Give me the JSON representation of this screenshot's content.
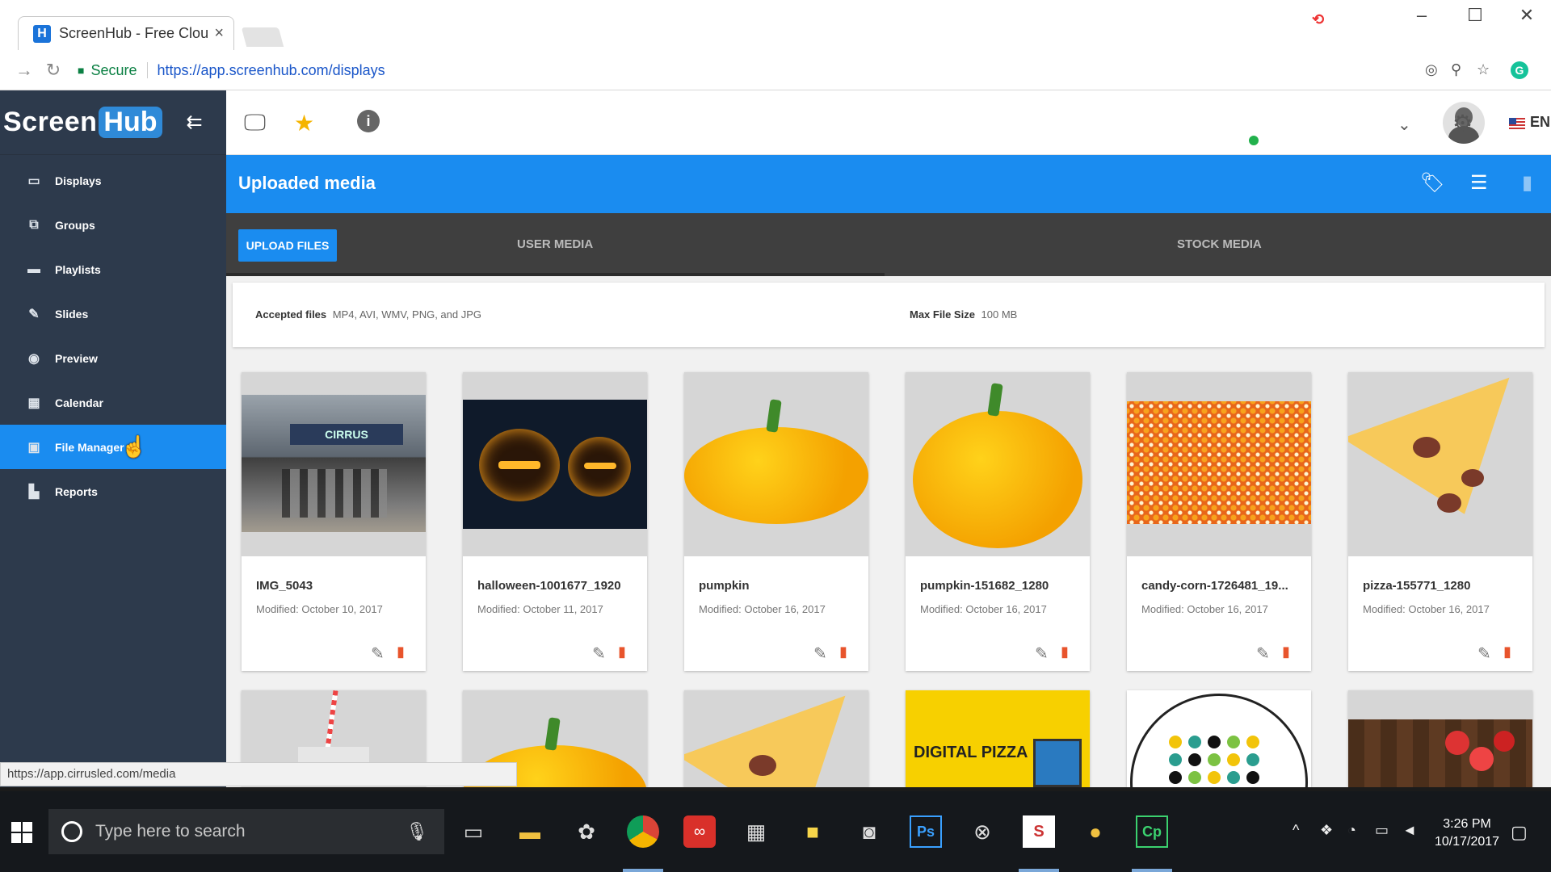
{
  "browser": {
    "tab_title": "ScreenHub - Free Clou",
    "tab_favicon": "H",
    "tab_close": "×",
    "secure_label": "Secure",
    "url": "https://app.screenhub.com/displays"
  },
  "sidebar": {
    "logo_screen": "Screen",
    "logo_hub": "Hub",
    "items": [
      {
        "label": "Displays",
        "icon": "monitor-icon",
        "glyph": "▭"
      },
      {
        "label": "Groups",
        "icon": "groups-icon",
        "glyph": "⧉"
      },
      {
        "label": "Playlists",
        "icon": "playlist-icon",
        "glyph": "▬"
      },
      {
        "label": "Slides",
        "icon": "pencil-icon",
        "glyph": "✎"
      },
      {
        "label": "Preview",
        "icon": "eye-icon",
        "glyph": "◉"
      },
      {
        "label": "Calendar",
        "icon": "calendar-icon",
        "glyph": "▦"
      },
      {
        "label": "File Manager",
        "icon": "image-icon",
        "glyph": "▣"
      },
      {
        "label": "Reports",
        "icon": "chart-icon",
        "glyph": "▙"
      }
    ],
    "active_index": 6
  },
  "topbar": {
    "language": "EN"
  },
  "header": {
    "title": "Uploaded media"
  },
  "tabs": {
    "upload_label": "UPLOAD FILES",
    "user_media": "USER MEDIA",
    "stock_media": "STOCK MEDIA"
  },
  "info": {
    "accepted_label": "Accepted files",
    "accepted_value": "MP4, AVI, WMV, PNG, and JPG",
    "max_label": "Max File Size",
    "max_value": "100 MB"
  },
  "media": [
    {
      "name": "IMG_5043",
      "modified": "Modified: October 10, 2017",
      "thumb": "storefront-photo"
    },
    {
      "name": "halloween-1001677_1920",
      "modified": "Modified: October 11, 2017",
      "thumb": "jack-o-lanterns"
    },
    {
      "name": "pumpkin",
      "modified": "Modified: October 16, 2017",
      "thumb": "pumpkin"
    },
    {
      "name": "pumpkin-151682_1280",
      "modified": "Modified: October 16, 2017",
      "thumb": "pumpkin-large"
    },
    {
      "name": "candy-corn-1726481_19...",
      "modified": "Modified: October 16, 2017",
      "thumb": "candy-corn"
    },
    {
      "name": "pizza-155771_1280",
      "modified": "Modified: October 16, 2017",
      "thumb": "pizza-slice"
    }
  ],
  "media_row2": [
    {
      "thumb": "drink-straw"
    },
    {
      "thumb": "pumpkin"
    },
    {
      "thumb": "pizza-slice"
    },
    {
      "thumb": "digital-pizza-sign",
      "text": "DIGITAL PIZZA"
    },
    {
      "thumb": "dots-logo"
    },
    {
      "thumb": "tomatoes-wood"
    }
  ],
  "status_url": "https://app.cirrusled.com/media",
  "taskbar": {
    "search_placeholder": "Type here to search",
    "time": "3:26 PM",
    "date": "10/17/2017"
  }
}
